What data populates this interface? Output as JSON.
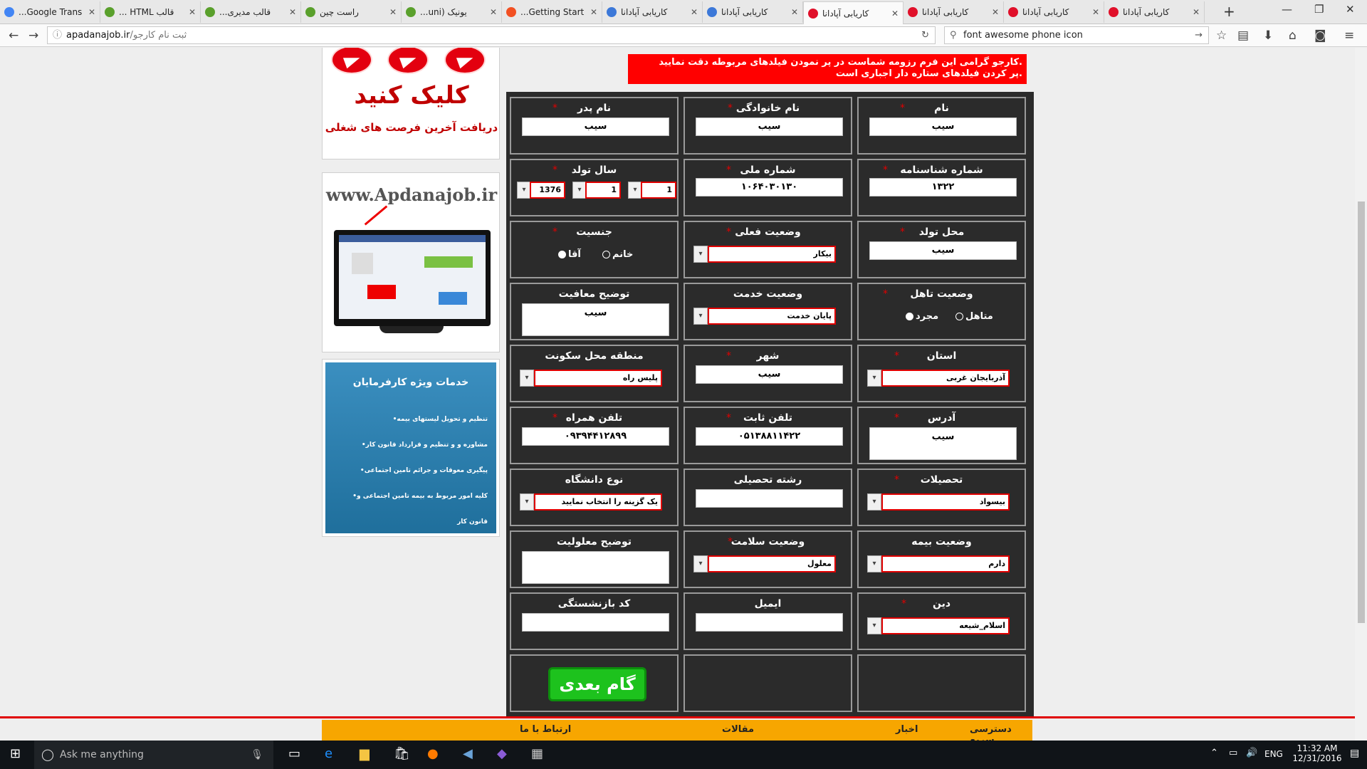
{
  "browser": {
    "tabs": [
      {
        "title": "Google Trans...",
        "color": "#4285f4"
      },
      {
        "title": "قالب HTML ...",
        "color": "#5aa02c"
      },
      {
        "title": "قالب مدیری...",
        "color": "#5aa02c"
      },
      {
        "title": "راست چین",
        "color": "#5aa02c"
      },
      {
        "title": "یونیک (uni...",
        "color": "#5aa02c"
      },
      {
        "title": "Getting Start...",
        "color": "#f25022"
      },
      {
        "title": "کاریابی آپادانا",
        "color": "#3c78d8"
      },
      {
        "title": "کاریابی آپادانا",
        "color": "#3c78d8"
      },
      {
        "title": "کاریابی آپادانا",
        "color": "#e0102a"
      },
      {
        "title": "کاریابی آپادانا",
        "color": "#e0102a"
      },
      {
        "title": "کاریابی آپادانا",
        "color": "#e0102a"
      },
      {
        "title": "کاریابی آپادانا",
        "color": "#e0102a"
      }
    ],
    "url_host": "apadanajob.ir",
    "url_path": "/ثبت نام کارجو",
    "search_text": "font awesome phone icon"
  },
  "sidebar": {
    "click_title": "کلیک کنید",
    "click_sub": "دریافت آخرین فرصت های شغلی",
    "site_text": "www.Apdanajob.ir",
    "services_title": "خدمات ویژه کارفرمایان",
    "services_items": [
      "•تنظیم و تحویل لیستهای بیمه",
      "•مشاوره و و تنظیم و قرارداد قانون کار",
      "•پیگیری معوقات و جرائم تامین اجتماعی",
      "•کلیه امور مربوط به بیمه تامین اجتماعی و قانون کار"
    ]
  },
  "notice": {
    "line1": "کارجو گرامی این فرم رزومه شماست در پر نمودن فیلدهای مربوطه دقت نمایید.",
    "line2": "پر کردن فیلدهای ستاره دار اجباری است."
  },
  "form": {
    "first_name": {
      "label": "نام",
      "value": "سیب"
    },
    "last_name": {
      "label": "نام خانوادگی",
      "value": "سیب"
    },
    "father_name": {
      "label": "نام پدر",
      "value": "سیب"
    },
    "id_number": {
      "label": "شماره شناسنامه",
      "value": "۱۳۲۲"
    },
    "national_id": {
      "label": "شماره ملی",
      "value": "۱۰۶۴۰۳۰۱۳۰"
    },
    "birth_year": {
      "label": "سال تولد",
      "day": "1",
      "month": "1",
      "year": "1376"
    },
    "birth_place": {
      "label": "محل تولد",
      "value": "سیب"
    },
    "current_status": {
      "label": "وضعیت فعلی",
      "value": "بیکار"
    },
    "gender": {
      "label": "جنسیت",
      "option1": "خانم",
      "option2": "آقا"
    },
    "marital": {
      "label": "وضعیت تاهل",
      "option1": "متاهل",
      "option2": "مجرد"
    },
    "military": {
      "label": "وضعیت خدمت",
      "value": "پایان خدمت"
    },
    "exemption": {
      "label": "توضیح معافیت",
      "value": "سیب"
    },
    "province": {
      "label": "استان",
      "value": "آذربایجان غربی"
    },
    "city": {
      "label": "شهر",
      "value": "سیب"
    },
    "district": {
      "label": "منطقه محل سکونت",
      "value": "پلیس راه"
    },
    "address": {
      "label": "آدرس",
      "value": "سیب"
    },
    "phone": {
      "label": "تلفن ثابت",
      "value": "۰۵۱۳۸۸۱۱۴۲۲"
    },
    "mobile": {
      "label": "تلفن همراه",
      "value": "۰۹۳۹۴۴۱۲۸۹۹"
    },
    "education": {
      "label": "تحصیلات",
      "value": "بیسواد"
    },
    "field": {
      "label": "رشته تحصیلی",
      "value": ""
    },
    "university": {
      "label": "نوع دانشگاه",
      "value": "یک گزینه را انتخاب نمایید"
    },
    "insurance": {
      "label": "وضعیت بیمه",
      "value": "دارم"
    },
    "health": {
      "label": "وضعیت سلامت",
      "value": "معلول"
    },
    "disability": {
      "label": "توضیح معلولیت",
      "value": ""
    },
    "religion": {
      "label": "دین",
      "value": "اسلام_شیعه"
    },
    "email": {
      "label": "ایمیل",
      "value": ""
    },
    "retire_code": {
      "label": "کد بازنشستگی",
      "value": ""
    },
    "next_button": "گام بعدی"
  },
  "footer": {
    "quick": "دسترسی سریع",
    "news": "اخبار",
    "articles": "مقالات",
    "contact": "ارتباط با ما"
  },
  "taskbar": {
    "search_placeholder": "Ask me anything",
    "lang": "ENG",
    "time": "11:32 AM",
    "date": "12/31/2016"
  }
}
